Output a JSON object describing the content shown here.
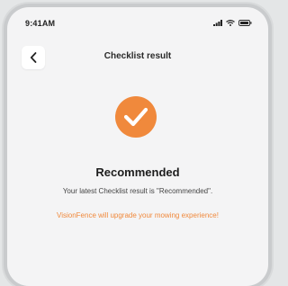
{
  "status_bar": {
    "time": "9:41AM",
    "icons": [
      "signal-icon",
      "wifi-icon",
      "battery-icon"
    ]
  },
  "header": {
    "title": "Checklist result",
    "back_icon": "chevron-left-icon"
  },
  "result": {
    "icon": "check-circle-icon",
    "title": "Recommended",
    "description": "Your latest Checklist result is \"Recommended\".",
    "note": "VisionFence will upgrade your mowing experience!"
  },
  "colors": {
    "accent": "#f0893c",
    "background": "#f4f4f5",
    "frame": "#e4e6e7"
  }
}
